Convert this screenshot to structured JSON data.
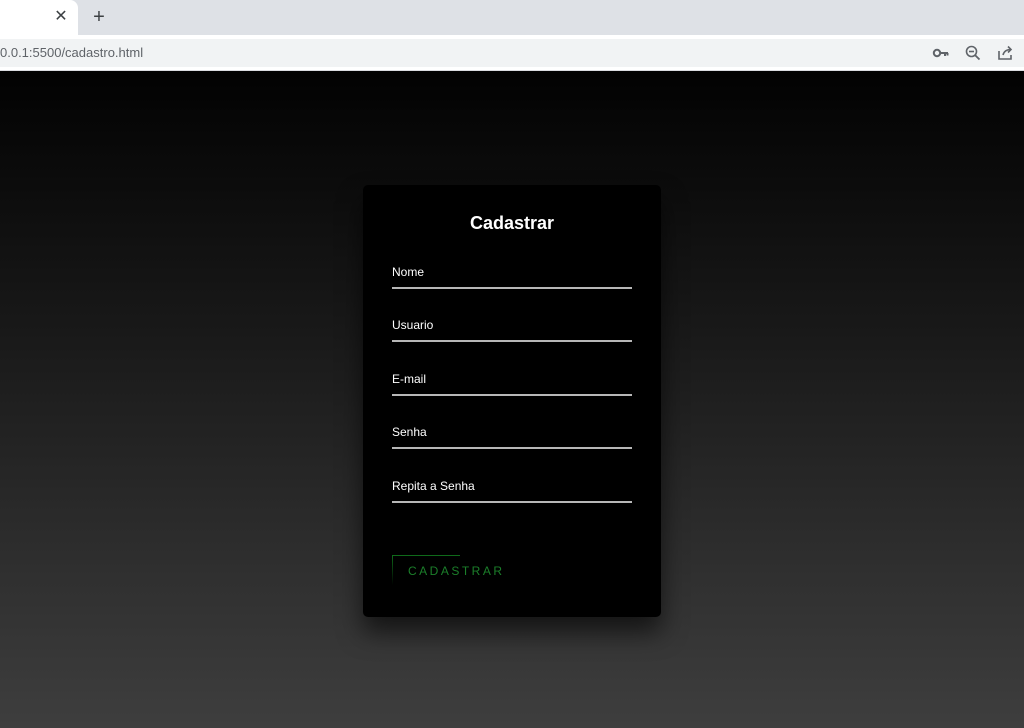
{
  "browser": {
    "url": "0.0.1:5500/cadastro.html",
    "tab_close_glyph": "✕",
    "new_tab_glyph": "+",
    "icons": [
      "key-icon",
      "zoom-out-icon",
      "share-icon"
    ]
  },
  "form": {
    "title": "Cadastrar",
    "fields": [
      {
        "label": "Nome"
      },
      {
        "label": "Usuario"
      },
      {
        "label": "E-mail"
      },
      {
        "label": "Senha"
      },
      {
        "label": "Repita a Senha"
      }
    ],
    "submit_label": "CADASTRAR"
  },
  "colors": {
    "card_bg": "#000000",
    "accent_green": "#1b7f2a",
    "field_line": "#b7b7b7"
  }
}
